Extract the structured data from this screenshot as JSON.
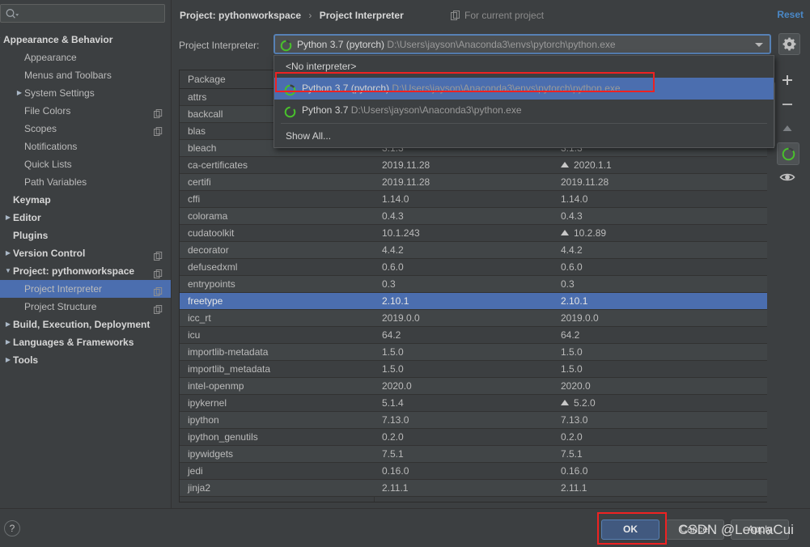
{
  "search": {
    "placeholder": "",
    "value": "",
    "icon": "search-icon"
  },
  "sidebar": {
    "items": [
      {
        "label": "Appearance & Behavior",
        "indent": 4,
        "twisty": "down",
        "bold": true,
        "copy": false,
        "selected": false
      },
      {
        "label": "Appearance",
        "indent": 30,
        "twisty": "none",
        "bold": false,
        "copy": false,
        "selected": false
      },
      {
        "label": "Menus and Toolbars",
        "indent": 30,
        "twisty": "none",
        "bold": false,
        "copy": false,
        "selected": false
      },
      {
        "label": "System Settings",
        "indent": 30,
        "twisty": "right",
        "bold": false,
        "copy": false,
        "selected": false
      },
      {
        "label": "File Colors",
        "indent": 30,
        "twisty": "none",
        "bold": false,
        "copy": true,
        "selected": false
      },
      {
        "label": "Scopes",
        "indent": 30,
        "twisty": "none",
        "bold": false,
        "copy": true,
        "selected": false
      },
      {
        "label": "Notifications",
        "indent": 30,
        "twisty": "none",
        "bold": false,
        "copy": false,
        "selected": false
      },
      {
        "label": "Quick Lists",
        "indent": 30,
        "twisty": "none",
        "bold": false,
        "copy": false,
        "selected": false
      },
      {
        "label": "Path Variables",
        "indent": 30,
        "twisty": "none",
        "bold": false,
        "copy": false,
        "selected": false
      },
      {
        "label": "Keymap",
        "indent": 16,
        "twisty": "none",
        "bold": true,
        "copy": false,
        "selected": false
      },
      {
        "label": "Editor",
        "indent": 16,
        "twisty": "right",
        "bold": true,
        "copy": false,
        "selected": false
      },
      {
        "label": "Plugins",
        "indent": 16,
        "twisty": "none",
        "bold": true,
        "copy": false,
        "selected": false
      },
      {
        "label": "Version Control",
        "indent": 16,
        "twisty": "right",
        "bold": true,
        "copy": true,
        "selected": false
      },
      {
        "label": "Project: pythonworkspace",
        "indent": 16,
        "twisty": "down",
        "bold": true,
        "copy": true,
        "selected": false
      },
      {
        "label": "Project Interpreter",
        "indent": 30,
        "twisty": "none",
        "bold": false,
        "copy": true,
        "selected": true
      },
      {
        "label": "Project Structure",
        "indent": 30,
        "twisty": "none",
        "bold": false,
        "copy": true,
        "selected": false
      },
      {
        "label": "Build, Execution, Deployment",
        "indent": 16,
        "twisty": "right",
        "bold": true,
        "copy": false,
        "selected": false
      },
      {
        "label": "Languages & Frameworks",
        "indent": 16,
        "twisty": "right",
        "bold": true,
        "copy": false,
        "selected": false
      },
      {
        "label": "Tools",
        "indent": 16,
        "twisty": "right",
        "bold": true,
        "copy": false,
        "selected": false
      }
    ]
  },
  "header": {
    "breadcrumb_root": "Project: pythonworkspace",
    "breadcrumb_sep": "›",
    "breadcrumb_leaf": "Project Interpreter",
    "for_current_project": "For current project",
    "for_current_icon": "copy-icon",
    "reset_label": "Reset"
  },
  "interpreter": {
    "field_label": "Project Interpreter:",
    "selected_name": "Python 3.7 (pytorch)",
    "selected_path": "D:\\Users\\jayson\\Anaconda3\\envs\\pytorch\\python.exe",
    "icon": "python-env-icon",
    "dropdown_arrow": "chevron-down-icon",
    "gear_icon": "gear-icon"
  },
  "dropdown": {
    "items": [
      {
        "name": "<No interpreter>",
        "path": "",
        "icon": "none",
        "selected": false,
        "highlighted": false
      },
      {
        "name": "Python 3.7 (pytorch)",
        "path": "D:\\Users\\jayson\\Anaconda3\\envs\\pytorch\\python.exe",
        "icon": "python-env-icon",
        "selected": true,
        "highlighted": true
      },
      {
        "name": "Python 3.7",
        "path": "D:\\Users\\jayson\\Anaconda3\\python.exe",
        "icon": "python-env-icon",
        "selected": false,
        "highlighted": false
      },
      {
        "name": "Show All...",
        "path": "",
        "icon": "none",
        "selected": false,
        "highlighted": false
      }
    ]
  },
  "packages": {
    "columns": [
      "Package",
      "Version",
      "Latest version"
    ],
    "rows": [
      {
        "name": "attrs",
        "version": "",
        "latest": "",
        "upgrade": false,
        "selected": false
      },
      {
        "name": "backcall",
        "version": "",
        "latest": "",
        "upgrade": false,
        "selected": false
      },
      {
        "name": "blas",
        "version": "",
        "latest": "",
        "upgrade": false,
        "selected": false
      },
      {
        "name": "bleach",
        "version": "3.1.3",
        "latest": "3.1.3",
        "upgrade": false,
        "selected": false
      },
      {
        "name": "ca-certificates",
        "version": "2019.11.28",
        "latest": "2020.1.1",
        "upgrade": true,
        "selected": false
      },
      {
        "name": "certifi",
        "version": "2019.11.28",
        "latest": "2019.11.28",
        "upgrade": false,
        "selected": false
      },
      {
        "name": "cffi",
        "version": "1.14.0",
        "latest": "1.14.0",
        "upgrade": false,
        "selected": false
      },
      {
        "name": "colorama",
        "version": "0.4.3",
        "latest": "0.4.3",
        "upgrade": false,
        "selected": false
      },
      {
        "name": "cudatoolkit",
        "version": "10.1.243",
        "latest": "10.2.89",
        "upgrade": true,
        "selected": false
      },
      {
        "name": "decorator",
        "version": "4.4.2",
        "latest": "4.4.2",
        "upgrade": false,
        "selected": false
      },
      {
        "name": "defusedxml",
        "version": "0.6.0",
        "latest": "0.6.0",
        "upgrade": false,
        "selected": false
      },
      {
        "name": "entrypoints",
        "version": "0.3",
        "latest": "0.3",
        "upgrade": false,
        "selected": false
      },
      {
        "name": "freetype",
        "version": "2.10.1",
        "latest": "2.10.1",
        "upgrade": false,
        "selected": true
      },
      {
        "name": "icc_rt",
        "version": "2019.0.0",
        "latest": "2019.0.0",
        "upgrade": false,
        "selected": false
      },
      {
        "name": "icu",
        "version": "64.2",
        "latest": "64.2",
        "upgrade": false,
        "selected": false
      },
      {
        "name": "importlib-metadata",
        "version": "1.5.0",
        "latest": "1.5.0",
        "upgrade": false,
        "selected": false
      },
      {
        "name": "importlib_metadata",
        "version": "1.5.0",
        "latest": "1.5.0",
        "upgrade": false,
        "selected": false
      },
      {
        "name": "intel-openmp",
        "version": "2020.0",
        "latest": "2020.0",
        "upgrade": false,
        "selected": false
      },
      {
        "name": "ipykernel",
        "version": "5.1.4",
        "latest": "5.2.0",
        "upgrade": true,
        "selected": false
      },
      {
        "name": "ipython",
        "version": "7.13.0",
        "latest": "7.13.0",
        "upgrade": false,
        "selected": false
      },
      {
        "name": "ipython_genutils",
        "version": "0.2.0",
        "latest": "0.2.0",
        "upgrade": false,
        "selected": false
      },
      {
        "name": "ipywidgets",
        "version": "7.5.1",
        "latest": "7.5.1",
        "upgrade": false,
        "selected": false
      },
      {
        "name": "jedi",
        "version": "0.16.0",
        "latest": "0.16.0",
        "upgrade": false,
        "selected": false
      },
      {
        "name": "jinja2",
        "version": "2.11.1",
        "latest": "2.11.1",
        "upgrade": false,
        "selected": false
      }
    ]
  },
  "side_tools": [
    {
      "icon": "plus-icon",
      "name": "install-package-button",
      "active": false
    },
    {
      "icon": "minus-icon",
      "name": "uninstall-package-button",
      "active": false
    },
    {
      "icon": "arrow-up-icon",
      "name": "upgrade-package-button",
      "active": false
    },
    {
      "icon": "python-env-icon",
      "name": "show-environment-button",
      "active": true
    },
    {
      "icon": "eye-icon",
      "name": "show-early-releases-button",
      "active": false
    }
  ],
  "bottom": {
    "help_label": "?",
    "ok_label": "OK",
    "cancel_label": "Cancel",
    "apply_label": "Apply"
  },
  "watermark": {
    "text": "CSDN @LeonaCui"
  },
  "colors": {
    "background": "#3c3f41",
    "selection": "#4b6eaf",
    "accent_link": "#4a88c7",
    "highlight_box": "#ee2222",
    "python_icon_green": "#49c02c"
  }
}
